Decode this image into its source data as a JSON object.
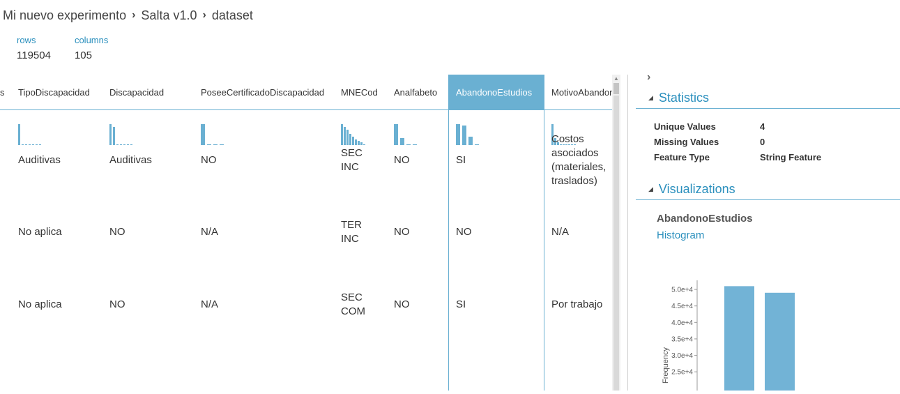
{
  "breadcrumb": [
    "Mi nuevo experimento",
    "Salta v1.0",
    "dataset"
  ],
  "summary": {
    "rows_label": "rows",
    "rows_value": "119504",
    "columns_label": "columns",
    "columns_value": "105"
  },
  "table": {
    "columns": [
      {
        "key": "prev",
        "header": "s"
      },
      {
        "key": "tipo",
        "header": "TipoDiscapacidad"
      },
      {
        "key": "disc",
        "header": "Discapacidad"
      },
      {
        "key": "cert",
        "header": "PoseeCertificadoDiscapacidad"
      },
      {
        "key": "mne",
        "header": "MNECod"
      },
      {
        "key": "anal",
        "header": "Analfabeto"
      },
      {
        "key": "aband",
        "header": "AbandonoEstudios",
        "selected": true
      },
      {
        "key": "motivo",
        "header": "MotivoAbandono"
      }
    ],
    "rows": [
      [
        "",
        "Auditivas",
        "Auditivas",
        "NO",
        "SEC\nINC",
        "NO",
        "SI",
        "Costos\nasociados\n(materiales,\ntraslados)"
      ],
      [
        "",
        "No aplica",
        "NO",
        "N/A",
        "TER\nINC",
        "NO",
        "NO",
        "N/A"
      ],
      [
        "",
        "No aplica",
        "NO",
        "N/A",
        "SEC\nCOM",
        "NO",
        "SI",
        "Por trabajo"
      ]
    ]
  },
  "panel": {
    "statistics_title": "Statistics",
    "stats": [
      {
        "label": "Unique Values",
        "value": "4"
      },
      {
        "label": "Missing Values",
        "value": "0"
      },
      {
        "label": "Feature Type",
        "value": "String Feature"
      }
    ],
    "visualizations_title": "Visualizations",
    "viz_column": "AbandonoEstudios",
    "viz_type": "Histogram"
  },
  "chart_data": {
    "type": "bar",
    "y_tick_labels": [
      "5.0e+4",
      "4.5e+4",
      "4.0e+4",
      "3.5e+4",
      "3.0e+4",
      "2.5e+4"
    ],
    "ylabel": "Frequency",
    "visible_range": [
      22500,
      51500
    ],
    "values": [
      51000,
      49000
    ]
  },
  "colors": {
    "accent": "#6ab0d2",
    "link": "#2a8fbd",
    "bar": "#72b3d6"
  }
}
